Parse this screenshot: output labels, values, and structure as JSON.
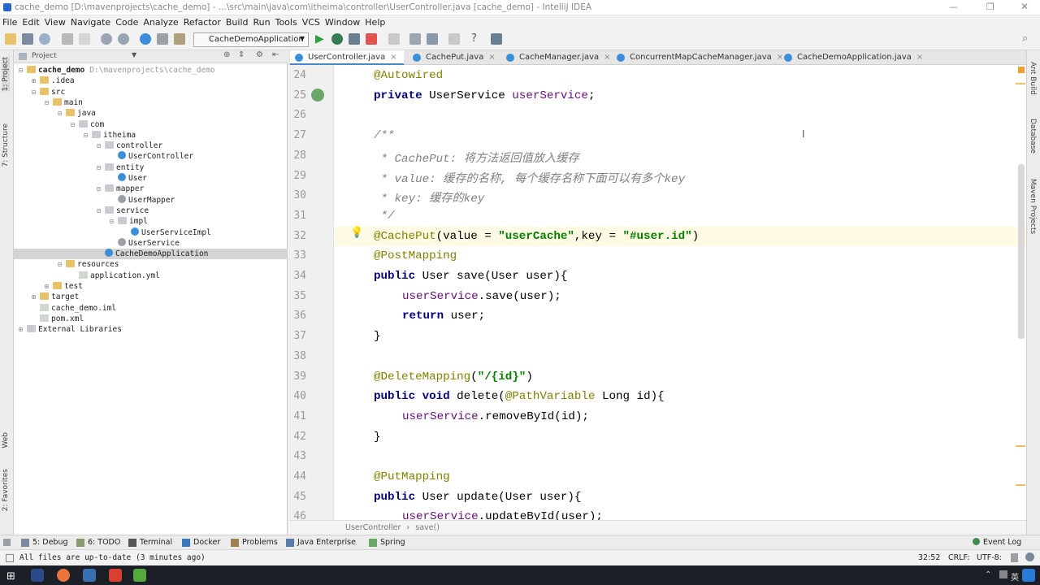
{
  "window": {
    "title": "cache_demo [D:\\mavenprojects\\cache_demo] - ...\\src\\main\\java\\com\\itheima\\controller\\UserController.java [cache_demo] - IntelliJ IDEA"
  },
  "menu": [
    "File",
    "Edit",
    "View",
    "Navigate",
    "Code",
    "Analyze",
    "Refactor",
    "Build",
    "Run",
    "Tools",
    "VCS",
    "Window",
    "Help"
  ],
  "toolbar": {
    "run_config": "CacheDemoApplication"
  },
  "left_strip": {
    "project": "1: Project",
    "structure": "7: Structure",
    "web": "Web",
    "favorites": "2: Favorites"
  },
  "project_panel": {
    "header": "Project",
    "tree": [
      {
        "label": "cache_demo",
        "extra": "D:\\mavenprojects\\cache_demo",
        "depth": 0,
        "icon": "folder",
        "arrow": "⊟",
        "bold": true
      },
      {
        "label": ".idea",
        "depth": 1,
        "icon": "folder",
        "arrow": "⊞"
      },
      {
        "label": "src",
        "depth": 1,
        "icon": "folder",
        "arrow": "⊟"
      },
      {
        "label": "main",
        "depth": 2,
        "icon": "folder",
        "arrow": "⊟"
      },
      {
        "label": "java",
        "depth": 3,
        "icon": "folder",
        "arrow": "⊟"
      },
      {
        "label": "com",
        "depth": 4,
        "icon": "package",
        "arrow": "⊟"
      },
      {
        "label": "itheima",
        "depth": 5,
        "icon": "package",
        "arrow": "⊟"
      },
      {
        "label": "controller",
        "depth": 6,
        "icon": "package",
        "arrow": "⊟"
      },
      {
        "label": "UserController",
        "depth": 7,
        "icon": "class",
        "arrow": ""
      },
      {
        "label": "entity",
        "depth": 6,
        "icon": "package",
        "arrow": "⊟"
      },
      {
        "label": "User",
        "depth": 7,
        "icon": "class",
        "arrow": ""
      },
      {
        "label": "mapper",
        "depth": 6,
        "icon": "package",
        "arrow": "⊟"
      },
      {
        "label": "UserMapper",
        "depth": 7,
        "icon": "interface",
        "arrow": ""
      },
      {
        "label": "service",
        "depth": 6,
        "icon": "package",
        "arrow": "⊟"
      },
      {
        "label": "impl",
        "depth": 7,
        "icon": "package",
        "arrow": "⊟"
      },
      {
        "label": "UserServiceImpl",
        "depth": 8,
        "icon": "class",
        "arrow": ""
      },
      {
        "label": "UserService",
        "depth": 7,
        "icon": "interface",
        "arrow": ""
      },
      {
        "label": "CacheDemoApplication",
        "depth": 6,
        "icon": "class",
        "arrow": "",
        "selected": true
      },
      {
        "label": "resources",
        "depth": 3,
        "icon": "folder",
        "arrow": "⊟"
      },
      {
        "label": "application.yml",
        "depth": 4,
        "icon": "file",
        "arrow": ""
      },
      {
        "label": "test",
        "depth": 2,
        "icon": "folder",
        "arrow": "⊞"
      },
      {
        "label": "target",
        "depth": 1,
        "icon": "folder",
        "arrow": "⊞"
      },
      {
        "label": "cache_demo.iml",
        "depth": 1,
        "icon": "file",
        "arrow": ""
      },
      {
        "label": "pom.xml",
        "depth": 1,
        "icon": "file",
        "arrow": ""
      },
      {
        "label": "External Libraries",
        "depth": 0,
        "icon": "lib",
        "arrow": "⊞"
      }
    ]
  },
  "tabs": [
    {
      "label": "UserController.java",
      "active": true
    },
    {
      "label": "CachePut.java"
    },
    {
      "label": "CacheManager.java"
    },
    {
      "label": "ConcurrentMapCacheManager.java"
    },
    {
      "label": "CacheDemoApplication.java"
    }
  ],
  "editor": {
    "lines": [
      {
        "n": "24",
        "indent": 0,
        "parts": [
          {
            "t": "@Autowired",
            "c": "an"
          }
        ]
      },
      {
        "n": "25",
        "indent": 0,
        "parts": [
          {
            "t": "private ",
            "c": "kw"
          },
          {
            "t": "UserService "
          },
          {
            "t": "userService",
            "c": "fld"
          },
          {
            "t": ";"
          }
        ]
      },
      {
        "n": "26",
        "indent": 0,
        "parts": []
      },
      {
        "n": "27",
        "indent": 0,
        "parts": [
          {
            "t": "/**",
            "c": "cm"
          }
        ]
      },
      {
        "n": "28",
        "indent": 0,
        "parts": [
          {
            "t": " * CachePut: 将方法返回值放入缓存",
            "c": "cm"
          }
        ]
      },
      {
        "n": "29",
        "indent": 0,
        "parts": [
          {
            "t": " * value: 缓存的名称, 每个缓存名称下面可以有多个key",
            "c": "cm"
          }
        ]
      },
      {
        "n": "30",
        "indent": 0,
        "parts": [
          {
            "t": " * key: 缓存的key",
            "c": "cm"
          }
        ]
      },
      {
        "n": "31",
        "indent": 0,
        "parts": [
          {
            "t": " */",
            "c": "cm"
          }
        ]
      },
      {
        "n": "32",
        "indent": 0,
        "parts": [
          {
            "t": "@CachePut",
            "c": "an"
          },
          {
            "t": "(value = "
          },
          {
            "t": "\"userCache\"",
            "c": "str"
          },
          {
            "t": ",key = "
          },
          {
            "t": "\"#user.id\"",
            "c": "str"
          },
          {
            "t": ")"
          }
        ]
      },
      {
        "n": "33",
        "indent": 0,
        "parts": [
          {
            "t": "@PostMapping",
            "c": "an"
          }
        ]
      },
      {
        "n": "34",
        "indent": 0,
        "parts": [
          {
            "t": "public ",
            "c": "kw"
          },
          {
            "t": "User save(User user){"
          }
        ]
      },
      {
        "n": "35",
        "indent": 1,
        "parts": [
          {
            "t": "userService",
            "c": "fld"
          },
          {
            "t": ".save(user);"
          }
        ]
      },
      {
        "n": "36",
        "indent": 1,
        "parts": [
          {
            "t": "return ",
            "c": "kw"
          },
          {
            "t": "user;"
          }
        ]
      },
      {
        "n": "37",
        "indent": 0,
        "parts": [
          {
            "t": "}"
          }
        ]
      },
      {
        "n": "38",
        "indent": 0,
        "parts": []
      },
      {
        "n": "39",
        "indent": 0,
        "parts": [
          {
            "t": "@DeleteMapping",
            "c": "an"
          },
          {
            "t": "("
          },
          {
            "t": "\"/{id}\"",
            "c": "str"
          },
          {
            "t": ")"
          }
        ]
      },
      {
        "n": "40",
        "indent": 0,
        "parts": [
          {
            "t": "public void ",
            "c": "kw"
          },
          {
            "t": "delete("
          },
          {
            "t": "@PathVariable ",
            "c": "an"
          },
          {
            "t": "Long id){"
          }
        ]
      },
      {
        "n": "41",
        "indent": 1,
        "parts": [
          {
            "t": "userService",
            "c": "fld"
          },
          {
            "t": ".removeById(id);"
          }
        ]
      },
      {
        "n": "42",
        "indent": 0,
        "parts": [
          {
            "t": "}"
          }
        ]
      },
      {
        "n": "43",
        "indent": 0,
        "parts": []
      },
      {
        "n": "44",
        "indent": 0,
        "parts": [
          {
            "t": "@PutMapping",
            "c": "an"
          }
        ]
      },
      {
        "n": "45",
        "indent": 0,
        "parts": [
          {
            "t": "public ",
            "c": "kw"
          },
          {
            "t": "User update(User user){"
          }
        ]
      },
      {
        "n": "46",
        "indent": 1,
        "parts": [
          {
            "t": "userService",
            "c": "fld"
          },
          {
            "t": ".updateById(user);"
          }
        ]
      }
    ],
    "breadcrumb": [
      "UserController",
      "save()"
    ]
  },
  "right_strip": {
    "ant": "Ant Build",
    "database": "Database",
    "maven": "Maven Projects"
  },
  "bottom_tools": [
    {
      "label": "5: Debug"
    },
    {
      "label": "6: TODO"
    },
    {
      "label": "Terminal"
    },
    {
      "label": "Docker"
    },
    {
      "label": "Problems"
    },
    {
      "label": "Java Enterprise"
    },
    {
      "label": "Spring"
    }
  ],
  "event_log": "Event Log",
  "status": {
    "message": "All files are up-to-date (3 minutes ago)",
    "position": "32:52",
    "line_sep": "CRLF:",
    "encoding": "UTF-8:"
  },
  "colors": {
    "accent": "#4a86c8",
    "current_line": "#fffae3",
    "selection": "#d4d4d4"
  }
}
